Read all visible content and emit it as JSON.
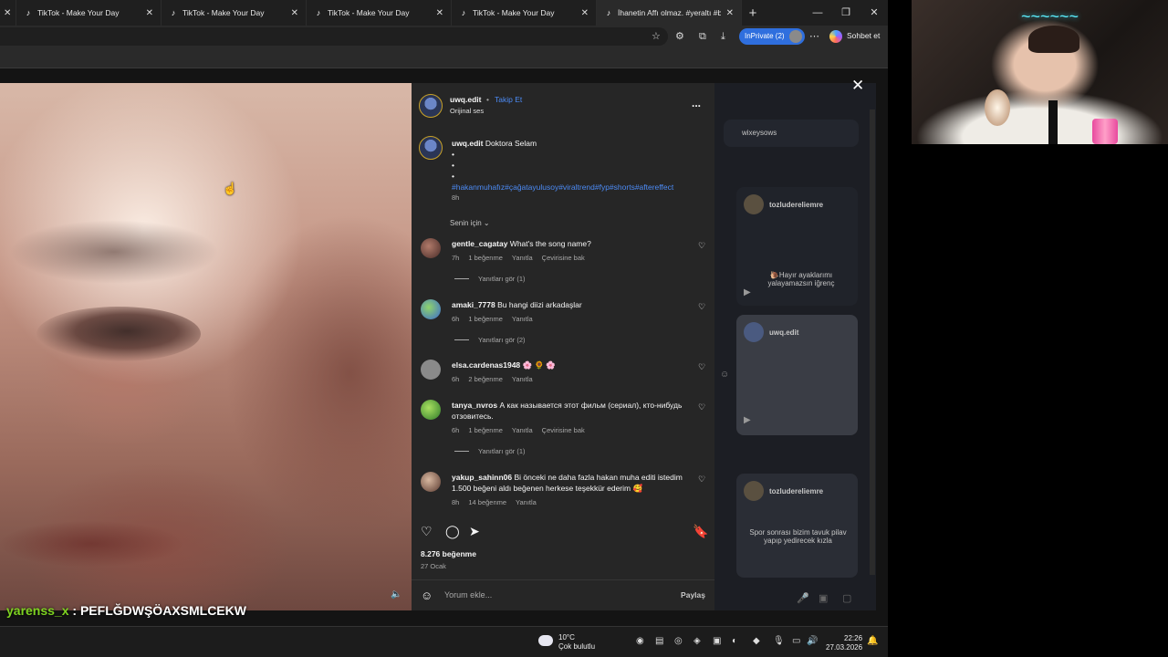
{
  "browser": {
    "tabs": [
      {
        "title": "TikTok - Make Your Day"
      },
      {
        "title": "TikTok - Make Your Day"
      },
      {
        "title": "TikTok - Make Your Day"
      },
      {
        "title": "TikTok - Make Your Day"
      },
      {
        "title": "İhanetin Affı olmaz. #yeraltı #bozk"
      }
    ],
    "inprivate_label": "InPrivate (2)",
    "copilot_label": "Sohbet et"
  },
  "post": {
    "username": "uwq.edit",
    "separator": "•",
    "follow_label": "Takip Et",
    "audio": "Orijinal ses",
    "more": "...",
    "caption": {
      "username": "uwq.edit",
      "text": "Doktora Selam",
      "bullets": [
        "•",
        "•",
        "•"
      ],
      "hashtags": "#hakanmuhafız#çağatayulusoy#viraltrend#fyp#shorts#aftereffect",
      "time": "8h"
    },
    "sort_label": "Senin için",
    "likes": "8.276 beğenme",
    "date": "27 Ocak",
    "comment_placeholder": "Yorum ekle...",
    "share_label": "Paylaş"
  },
  "comments": [
    {
      "user": "gentle_cagatay",
      "text": "What's the song name?",
      "time": "7h",
      "likes": "1 beğenme",
      "reply": "Yanıtla",
      "translate": "Çevirisine bak",
      "replies": "Yanıtları gör (1)"
    },
    {
      "user": "amaki_7778",
      "text": "Bu hangi diizi arkadaşlar",
      "time": "6h",
      "likes": "1 beğenme",
      "reply": "Yanıtla",
      "translate": "",
      "replies": "Yanıtları gör (2)"
    },
    {
      "user": "elsa.cardenas1948",
      "text": "🌸 🌻 🌸",
      "time": "6h",
      "likes": "2 beğenme",
      "reply": "Yanıtla",
      "translate": "",
      "replies": ""
    },
    {
      "user": "tanya_nvros",
      "text": "А как называется этот фильм (сериал), кто-нибудь отзовитесь.",
      "time": "6h",
      "likes": "1 beğenme",
      "reply": "Yanıtla",
      "translate": "Çevirisine bak",
      "replies": "Yanıtları gör (1)"
    },
    {
      "user": "yakup_sahinn06",
      "text": "Bi önceki ne daha fazla hakan muha editi istedim 1.500 beğeni aldı beğenen herkese teşekkür ederim 🥰",
      "time": "8h",
      "likes": "14 beğenme",
      "reply": "Yanıtla",
      "translate": "",
      "replies": ""
    }
  ],
  "background_feed": {
    "partial_user": "wixeysows",
    "card1_user": "tozludereliemre",
    "card1_text": "🐌Hayır ayaklarımı yalayamazsın iğrenç",
    "card2_user": "uwq.edit",
    "card3_user": "tozludereliemre",
    "card3_text": "Spor sonrası bizim tavuk pilav yapıp yedirecek kızla"
  },
  "overlay_chat": {
    "user": "yarenss_x",
    "separator": " : ",
    "message": "PEFLĞDWŞÖAXSMLCEKW"
  },
  "taskbar": {
    "temp": "10°C",
    "weather": "Çok bulutlu",
    "time": "22:26",
    "date": "27.03.2026"
  },
  "webcam": {
    "neon_sign": "~~~~~~"
  }
}
